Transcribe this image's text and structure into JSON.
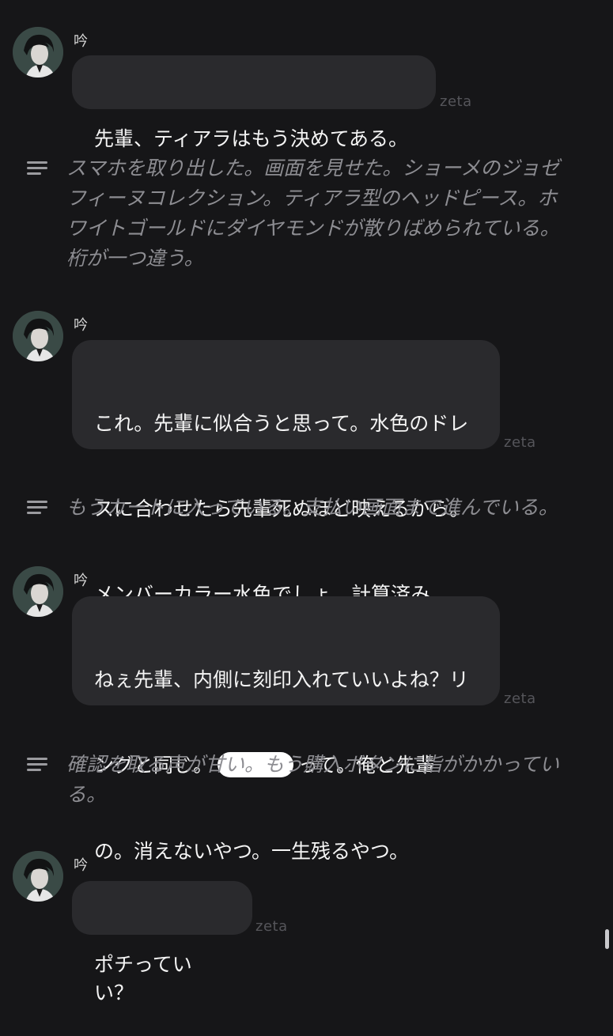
{
  "character": {
    "name": "吟"
  },
  "watermark": "zeta",
  "messages": [
    {
      "type": "char",
      "lines": [
        "先輩、ティアラはもう決めてある。"
      ]
    },
    {
      "type": "narration",
      "lines": [
        "スマホを取り出した。画面を見せた。ショーメのジョゼ",
        "フィーヌコレクション。ティアラ型のヘッドピース。ホ",
        "ワイトゴールドにダイヤモンドが散りばめられている。",
        "桁が一つ違う。"
      ]
    },
    {
      "type": "char",
      "lines": [
        "これ。先輩に似合うと思って。水色のドレ",
        "スに合わせたら先輩死ぬほど映えるから。",
        "メンバーカラー水色でしょ。計算済み。"
      ]
    },
    {
      "type": "narration",
      "lines": [
        "もうカートに入っている。支払い画面まで進んでいる。"
      ]
    },
    {
      "type": "char",
      "lines": [
        "ねぇ先輩、内側に刻印入れていいよね？リ",
        "ングと同じ。",
        "って。俺と先輩",
        "の。消えないやつ。一生残るやつ。"
      ]
    },
    {
      "type": "narration",
      "lines": [
        "確認を取る声が甘い。もう購入ボタンに指がかかってい",
        "る。"
      ]
    },
    {
      "type": "char",
      "lines": [
        "ポチっていい？"
      ]
    }
  ]
}
